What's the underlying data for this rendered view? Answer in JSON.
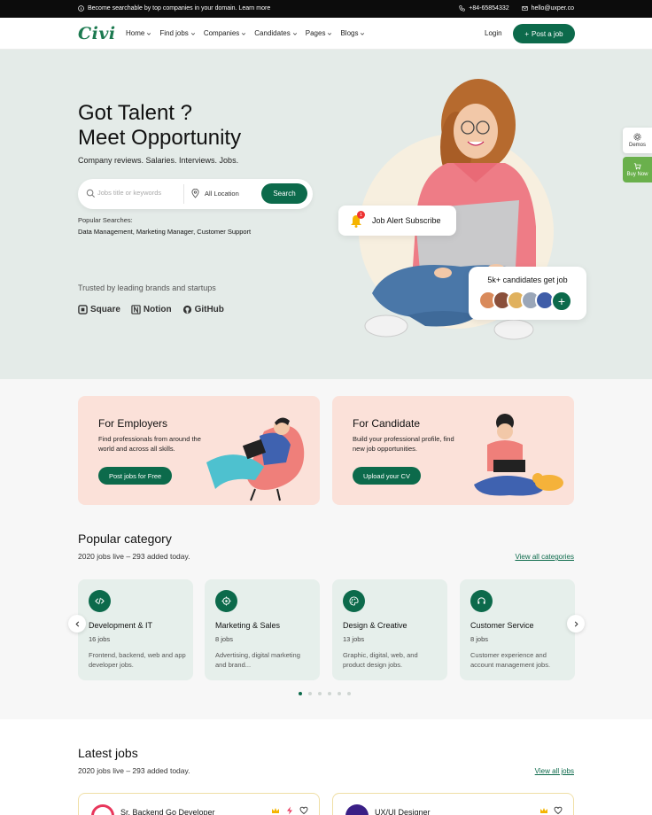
{
  "topbar": {
    "notice": "Become searchable by top companies in your domain. Learn more",
    "phone": "+84-65854332",
    "email": "hello@uxper.co"
  },
  "nav": {
    "logo": "Civi",
    "menu": [
      "Home",
      "Find jobs",
      "Companies",
      "Candidates",
      "Pages",
      "Blogs"
    ],
    "login": "Login",
    "post_job": "Post a job"
  },
  "hero": {
    "title_line1": "Got Talent ?",
    "title_line2": "Meet Opportunity",
    "subtitle": "Company reviews. Salaries. Interviews. Jobs.",
    "search_placeholder": "Jobs title or keywords",
    "location": "All Location",
    "search_button": "Search",
    "popular_label": "Popular Searches:",
    "popular_tags": [
      "Data Management,",
      "Marketing Manager,",
      "Customer Support"
    ],
    "trusted": "Trusted by leading brands and startups",
    "brands": [
      "Square",
      "Notion",
      "GitHub"
    ],
    "alert_card": "Job Alert Subscribe",
    "alert_badge": "1",
    "candidates_card": "5k+ candidates get job"
  },
  "side": {
    "demos": "Demos",
    "buy": "Buy Now"
  },
  "promos": {
    "employers": {
      "title": "For Employers",
      "text": "Find professionals from around the world and across all skills.",
      "button": "Post jobs for Free"
    },
    "candidate": {
      "title": "For Candidate",
      "text": "Build your professional profile, find new job opportunities.",
      "button": "Upload your CV"
    }
  },
  "categories": {
    "title": "Popular category",
    "subtitle": "2020 jobs live – 293 added today.",
    "view_all": "View all categories",
    "items": [
      {
        "name": "Development & IT",
        "count": "16 jobs",
        "desc": "Frontend, backend, web and app developer jobs.",
        "icon": "code-icon"
      },
      {
        "name": "Marketing & Sales",
        "count": "8 jobs",
        "desc": "Advertising, digital marketing and brand...",
        "icon": "target-icon"
      },
      {
        "name": "Design & Creative",
        "count": "13 jobs",
        "desc": "Graphic, digital, web, and product design jobs.",
        "icon": "palette-icon"
      },
      {
        "name": "Customer Service",
        "count": "8 jobs",
        "desc": "Customer experience and account management jobs.",
        "icon": "headset-icon"
      }
    ],
    "pagination_total": 6,
    "pagination_active": 1
  },
  "latest": {
    "title": "Latest jobs",
    "subtitle": "2020 jobs live – 293 added today.",
    "view_all": "View all jobs",
    "jobs": [
      {
        "title": "Sr. Backend Go Developer"
      },
      {
        "title": "UX/UI Designer"
      }
    ]
  },
  "colors": {
    "primary": "#0c6a4b",
    "hero_bg": "#e4ebe8",
    "promo_bg": "#fbe1d9",
    "category_bg": "#e6efeb"
  }
}
